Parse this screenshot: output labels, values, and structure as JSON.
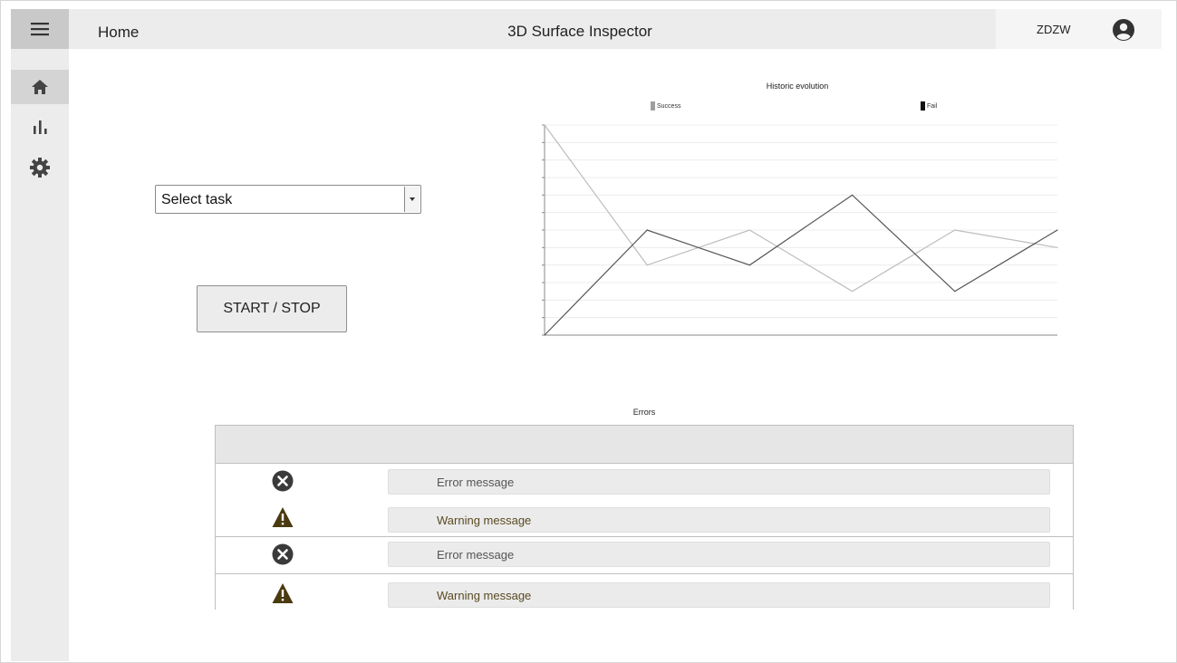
{
  "header": {
    "home_label": "Home",
    "app_title": "3D Surface Inspector",
    "user_name": "ZDZW"
  },
  "sidebar": {
    "menu_icon": "hamburger-icon",
    "items": [
      {
        "name": "home",
        "icon": "home-icon",
        "active": true
      },
      {
        "name": "statistics",
        "icon": "bar-chart-icon",
        "active": false
      },
      {
        "name": "settings",
        "icon": "gear-icon",
        "active": false
      }
    ]
  },
  "task_select": {
    "selected": "Select task"
  },
  "start_button": {
    "label": "START / STOP"
  },
  "chart_data": {
    "type": "line",
    "title": "Historic evolution",
    "legend_placement": "top",
    "grid": true,
    "x": [
      0,
      1,
      2,
      3,
      4,
      5
    ],
    "ylim": [
      0,
      12
    ],
    "series": [
      {
        "name": "Success",
        "color": "#bdbdbd",
        "values": [
          12,
          4,
          6,
          2.5,
          6,
          5
        ]
      },
      {
        "name": "Fail",
        "color": "#555555",
        "values": [
          0,
          6,
          4,
          8,
          2.5,
          6
        ]
      }
    ]
  },
  "errors": {
    "title": "Errors",
    "rows": [
      {
        "type": "error",
        "icon": "error-circle-icon",
        "message": "Error message"
      },
      {
        "type": "warning",
        "icon": "warning-triangle-icon",
        "message": "Warning message"
      },
      {
        "type": "error",
        "icon": "error-circle-icon",
        "message": "Error message"
      },
      {
        "type": "warning",
        "icon": "warning-triangle-icon",
        "message": "Warning message"
      }
    ]
  },
  "colors": {
    "warning": "#4a3a10",
    "error": "#3a3a3a",
    "success_line": "#bdbdbd",
    "fail_line": "#555555"
  }
}
